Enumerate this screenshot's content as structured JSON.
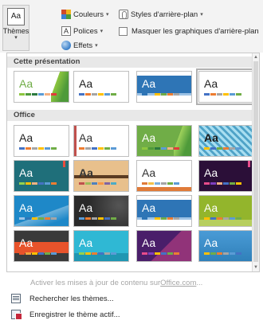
{
  "ribbon": {
    "themes_label": "Thèmes",
    "themes_icon_text": "Aa",
    "themes_caret": "▾",
    "colors_label": "Couleurs",
    "fonts_label": "Polices",
    "fonts_icon_text": "A",
    "effects_label": "Effets",
    "bg_styles_label": "Styles d'arrière-plan",
    "hide_bg_label": "Masquer les graphiques d'arrière-plan",
    "caret": "▾"
  },
  "gallery": {
    "section_current": "Cette présentation",
    "section_office": "Office",
    "thumb_text": "Aa",
    "scroll_up": "▲",
    "scroll_down": "▼"
  },
  "themes_current": [
    {
      "name": "green-facet",
      "bg": "#ffffff",
      "text": "#70ad47",
      "bars": [
        "#8dc63f",
        "#4e9a3a",
        "#2c7a3f",
        "#5b9bd5",
        "#f4b183",
        "#e03b3b"
      ]
    },
    {
      "name": "office-theme",
      "bg": "#ffffff",
      "text": "#222222",
      "bars": [
        "#4472c4",
        "#ed7d31",
        "#a5a5a5",
        "#ffc000",
        "#5b9bd5",
        "#70ad47"
      ]
    },
    {
      "name": "blue-banner",
      "bg": "#ffffff",
      "text": "#ffffff",
      "bars": [
        "#2e75b6",
        "#9dc3e6",
        "#ffc000",
        "#70ad47",
        "#ed7d31",
        "#a5a5a5"
      ]
    },
    {
      "name": "office-theme-selected",
      "bg": "#ffffff",
      "text": "#222222",
      "bars": [
        "#4472c4",
        "#ed7d31",
        "#a5a5a5",
        "#ffc000",
        "#5b9bd5",
        "#70ad47"
      ]
    }
  ],
  "themes_office": [
    {
      "name": "office-theme",
      "bg": "#ffffff",
      "text": "#222222",
      "bars": [
        "#4472c4",
        "#ed7d31",
        "#a5a5a5",
        "#ffc000",
        "#5b9bd5",
        "#70ad47"
      ]
    },
    {
      "name": "office-2013",
      "bg": "#ffffff",
      "text": "#333333",
      "bars": [
        "#ed7d31",
        "#a5a5a5",
        "#4472c4",
        "#ffc000",
        "#70ad47",
        "#5b9bd5"
      ]
    },
    {
      "name": "facet",
      "bg": "#ffffff",
      "text": "#ffffff",
      "bars": [
        "#8dc63f",
        "#4e9a3a",
        "#2c7a3f",
        "#5b9bd5",
        "#f4b183",
        "#e03b3b"
      ]
    },
    {
      "name": "ion-pattern",
      "bg": "#7ec8e3",
      "text": "#1a1a1a",
      "bars": [
        "#ffc000",
        "#4472c4",
        "#70ad47",
        "#ed7d31",
        "#a5a5a5",
        "#5b9bd5"
      ]
    },
    {
      "name": "ion-dark",
      "bg": "#1f6f7a",
      "text": "#ffffff",
      "bars": [
        "#92d050",
        "#ffc000",
        "#f4b183",
        "#4472c4",
        "#5b9bd5",
        "#ed7d31"
      ]
    },
    {
      "name": "wood-type",
      "bg": "#e8c08c",
      "text": "#333333",
      "bars": [
        "#c0504d",
        "#9bbb59",
        "#4f81bd",
        "#f79646",
        "#8064a2",
        "#4bacc6"
      ]
    },
    {
      "name": "retrospect",
      "bg": "#ffffff",
      "text": "#333333",
      "bars": [
        "#e07b39",
        "#f2c04a",
        "#7cafdd",
        "#a5a5a5",
        "#70ad47",
        "#5b9bd5"
      ]
    },
    {
      "name": "organic-purple",
      "bg": "#2b0f38",
      "text": "#ffffff",
      "bars": [
        "#e84c8b",
        "#7f3fbf",
        "#f4b183",
        "#4472c4",
        "#70ad47",
        "#ffc000"
      ]
    },
    {
      "name": "integral-blue",
      "bg": "#1e88c8",
      "text": "#ffffff",
      "bars": [
        "#9dc3e6",
        "#2e75b6",
        "#ffc000",
        "#70ad47",
        "#ed7d31",
        "#a5a5a5"
      ]
    },
    {
      "name": "mesh-dark",
      "bg": "#2a2a2a",
      "text": "#ffffff",
      "bars": [
        "#5b9bd5",
        "#ed7d31",
        "#a5a5a5",
        "#ffc000",
        "#4472c4",
        "#70ad47"
      ]
    },
    {
      "name": "slice",
      "bg": "#ffffff",
      "text": "#ffffff",
      "bars": [
        "#2e75b6",
        "#9dc3e6",
        "#ffc000",
        "#70ad47",
        "#ed7d31",
        "#a5a5a5"
      ]
    },
    {
      "name": "banded-green",
      "bg": "#93b52c",
      "text": "#ffffff",
      "bars": [
        "#ffc000",
        "#4472c4",
        "#ed7d31",
        "#a5a5a5",
        "#5b9bd5",
        "#70ad47"
      ]
    },
    {
      "name": "berlin",
      "bg": "#3a3a3a",
      "text": "#ffffff",
      "bars": [
        "#e8532b",
        "#f2a43c",
        "#ffc000",
        "#4472c4",
        "#70ad47",
        "#5b9bd5"
      ]
    },
    {
      "name": "view",
      "bg": "#2fb8d4",
      "text": "#ffffff",
      "bars": [
        "#92d050",
        "#ffc000",
        "#ed7d31",
        "#4472c4",
        "#a5a5a5",
        "#5b9bd5"
      ]
    },
    {
      "name": "parallax",
      "bg": "#4a1e6a",
      "text": "#ffffff",
      "bars": [
        "#e84c8b",
        "#7f3fbf",
        "#ffc000",
        "#4472c4",
        "#70ad47",
        "#ed7d31"
      ]
    },
    {
      "name": "savon",
      "bg": "#2e7fb8",
      "text": "#ffffff",
      "bars": [
        "#ffc000",
        "#70ad47",
        "#ed7d31",
        "#a5a5a5",
        "#5b9bd5",
        "#4472c4"
      ]
    }
  ],
  "menu": {
    "update_text": "Activer les mises à jour de contenu sur ",
    "update_link": "Office.com",
    "update_suffix": "...",
    "browse_label": "Rechercher les thèmes...",
    "save_label": "Enregistrer le thème actif..."
  },
  "colors": {
    "ribbon_bg": "#f3f3f3",
    "section_bg": "#e8e8e8",
    "disabled_text": "#a6a6a6"
  }
}
